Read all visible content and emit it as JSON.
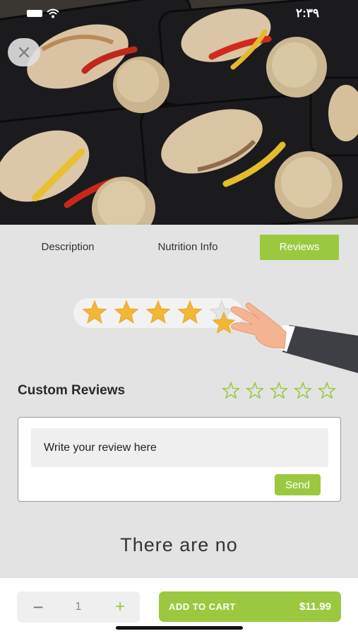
{
  "status_bar": {
    "time": "٢:٣٩"
  },
  "header": {
    "close_icon": "close-icon"
  },
  "tabs": [
    {
      "label": "Description",
      "active": false
    },
    {
      "label": "Nutrition Info",
      "active": false
    },
    {
      "label": "Reviews",
      "active": true
    }
  ],
  "illustration": {
    "stars_filled": 4,
    "stars_total": 5
  },
  "reviews": {
    "title": "Custom Reviews",
    "rating_stars_total": 5,
    "rating_selected": 0,
    "input_placeholder": "Write your review here",
    "send_label": "Send",
    "empty_message": "There are no"
  },
  "cart": {
    "quantity": "1",
    "minus_label": "−",
    "plus_label": "+",
    "add_label": "ADD TO CART",
    "price": "$11.99"
  },
  "colors": {
    "accent": "#9ac940",
    "background": "#e3e3e3",
    "star": "#f3b735"
  }
}
